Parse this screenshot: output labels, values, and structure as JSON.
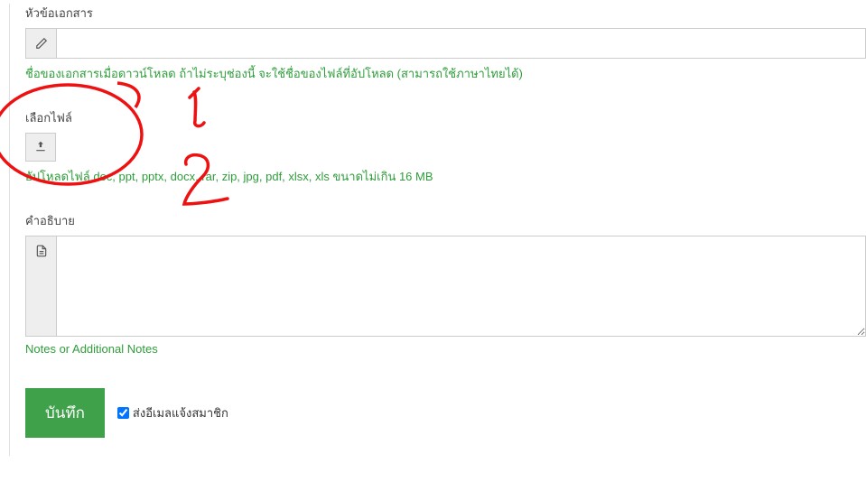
{
  "fields": {
    "title": {
      "label": "หัวข้อเอกสาร",
      "help": "ชื่อของเอกสารเมื่อดาวน์โหลด ถ้าไม่ระบุช่องนี้ จะใช้ชื่อของไฟล์ที่อัปโหลด (สามารถใช้ภาษาไทยได้)"
    },
    "file": {
      "label": "เลือกไฟล์",
      "help": "อัปโหลดไฟล์ doc, ppt, pptx, docx, rar, zip, jpg, pdf, xlsx, xls ขนาดไม่เกิน 16 MB"
    },
    "description": {
      "label": "คำอธิบาย",
      "notes": "Notes or Additional Notes"
    }
  },
  "actions": {
    "save": "บันทึก",
    "notify": "ส่งอีเมลแจ้งสมาชิก"
  },
  "annotations": {
    "mark1": "1",
    "mark2": "2"
  }
}
